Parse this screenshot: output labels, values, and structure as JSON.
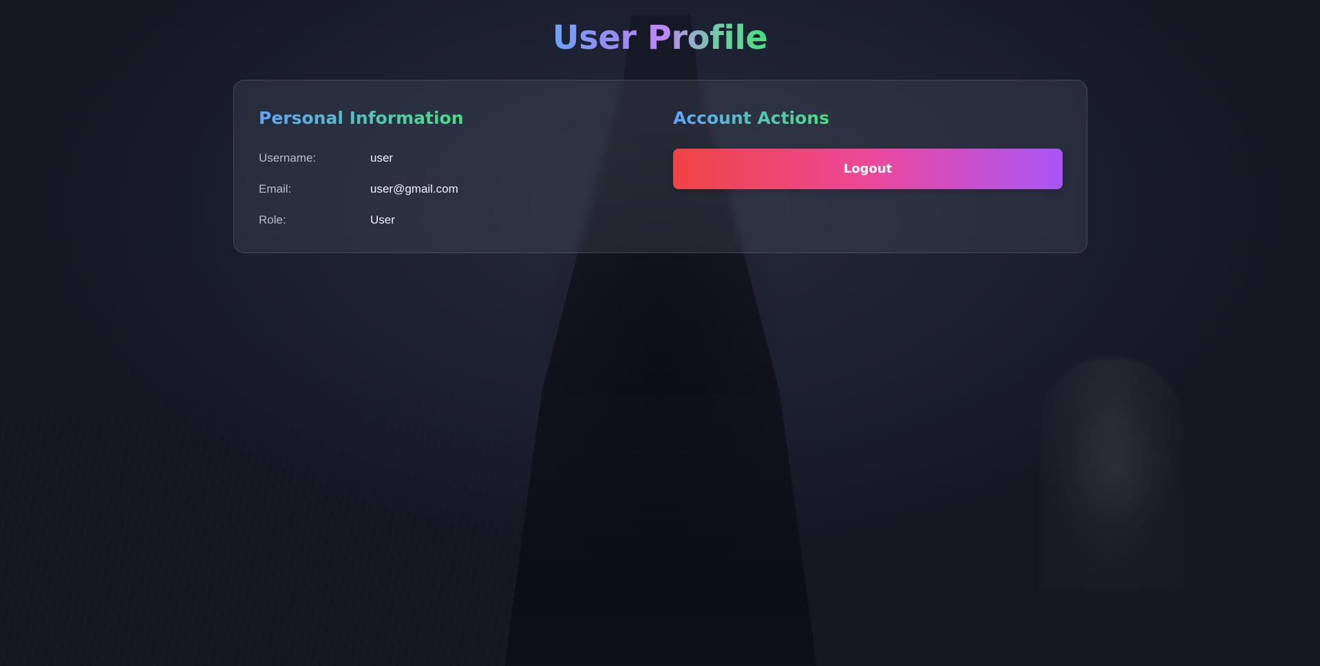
{
  "header": {
    "title": "User Profile"
  },
  "personal_info": {
    "title": "Personal Information",
    "rows": [
      {
        "label": "Username:",
        "value": "user"
      },
      {
        "label": "Email:",
        "value": "user@gmail.com"
      },
      {
        "label": "Role:",
        "value": "User"
      }
    ]
  },
  "account_actions": {
    "title": "Account Actions",
    "logout_label": "Logout"
  },
  "colors": {
    "title_gradient": [
      "#6aa3f7",
      "#c084fc",
      "#4ade80"
    ],
    "section_title_gradient": [
      "#60a5fa",
      "#4ade80"
    ],
    "logout_gradient": [
      "#ef4444",
      "#ec4899",
      "#a855f7"
    ],
    "background": "#1a1f2c"
  }
}
